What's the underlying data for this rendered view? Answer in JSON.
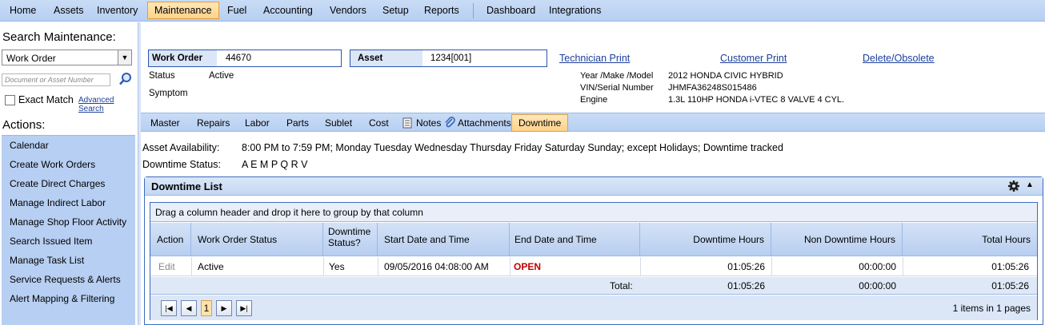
{
  "topmenu": {
    "items": [
      "Home",
      "Assets",
      "Inventory",
      "Maintenance",
      "Fuel",
      "Accounting",
      "Vendors",
      "Setup",
      "Reports",
      "Dashboard",
      "Integrations"
    ]
  },
  "left": {
    "search_title": "Search Maintenance:",
    "search_type": "Work Order",
    "search_placeholder": "Document or Asset Number",
    "exact_match_label": "Exact Match",
    "advanced_search": "Advanced Search",
    "actions_title": "Actions:",
    "actions": [
      "Calendar",
      "Create Work Orders",
      "Create Direct Charges",
      "Manage Indirect Labor",
      "Manage Shop Floor Activity",
      "Search Issued Item",
      "Manage Task List",
      "Service Requests & Alerts",
      "Alert Mapping & Filtering"
    ]
  },
  "header": {
    "work_order_label": "Work Order",
    "work_order_value": "44670",
    "asset_label": "Asset",
    "asset_value": "1234[001]",
    "status_label": "Status",
    "status_value": "Active",
    "symptom_label": "Symptom",
    "technician_print": "Technician Print",
    "customer_print": "Customer Print",
    "delete_obsolete": "Delete/Obsolete",
    "ymm_label": "Year /Make /Model",
    "ymm_value": "2012 HONDA CIVIC HYBRID",
    "vin_label": "VIN/Serial Number",
    "vin_value": "JHMFA36248S015486",
    "engine_label": "Engine",
    "engine_value": "1.3L 110HP HONDA i-VTEC 8 VALVE 4 CYL."
  },
  "tabs": [
    "Master",
    "Repairs",
    "Labor",
    "Parts",
    "Sublet",
    "Cost",
    "Notes",
    "Attachments",
    "Downtime"
  ],
  "availability": {
    "asset_availability_label": "Asset Availability:",
    "asset_availability_value": "8:00 PM to 7:59 PM; Monday Tuesday Wednesday Thursday Friday Saturday Sunday; except Holidays; Downtime tracked",
    "downtime_status_label": "Downtime Status:",
    "downtime_status_value": "A E M P Q R V"
  },
  "downtime_list": {
    "title": "Downtime List",
    "group_hint": "Drag a column header and drop it here to group by that column",
    "columns": [
      "Action",
      "Work Order Status",
      "Downtime Status?",
      "Start Date and Time",
      "End Date and Time",
      "Downtime Hours",
      "Non Downtime Hours",
      "Total Hours"
    ],
    "rows": [
      {
        "action": "Edit",
        "wo_status": "Active",
        "downtime_status": "Yes",
        "start": "09/05/2016 04:08:00 AM",
        "end": "OPEN",
        "downtime_hours": "01:05:26",
        "non_downtime_hours": "00:00:00",
        "total_hours": "01:05:26"
      }
    ],
    "total_label": "Total:",
    "totals": {
      "downtime_hours": "01:05:26",
      "non_downtime_hours": "00:00:00",
      "total_hours": "01:05:26"
    },
    "page": "1",
    "pager_info": "1 items in 1 pages"
  },
  "colors": {
    "menu_bg": "#b7cff2",
    "active_tab": "#ffd28a",
    "open_status": "#c00000",
    "link": "#1b3f9b"
  }
}
